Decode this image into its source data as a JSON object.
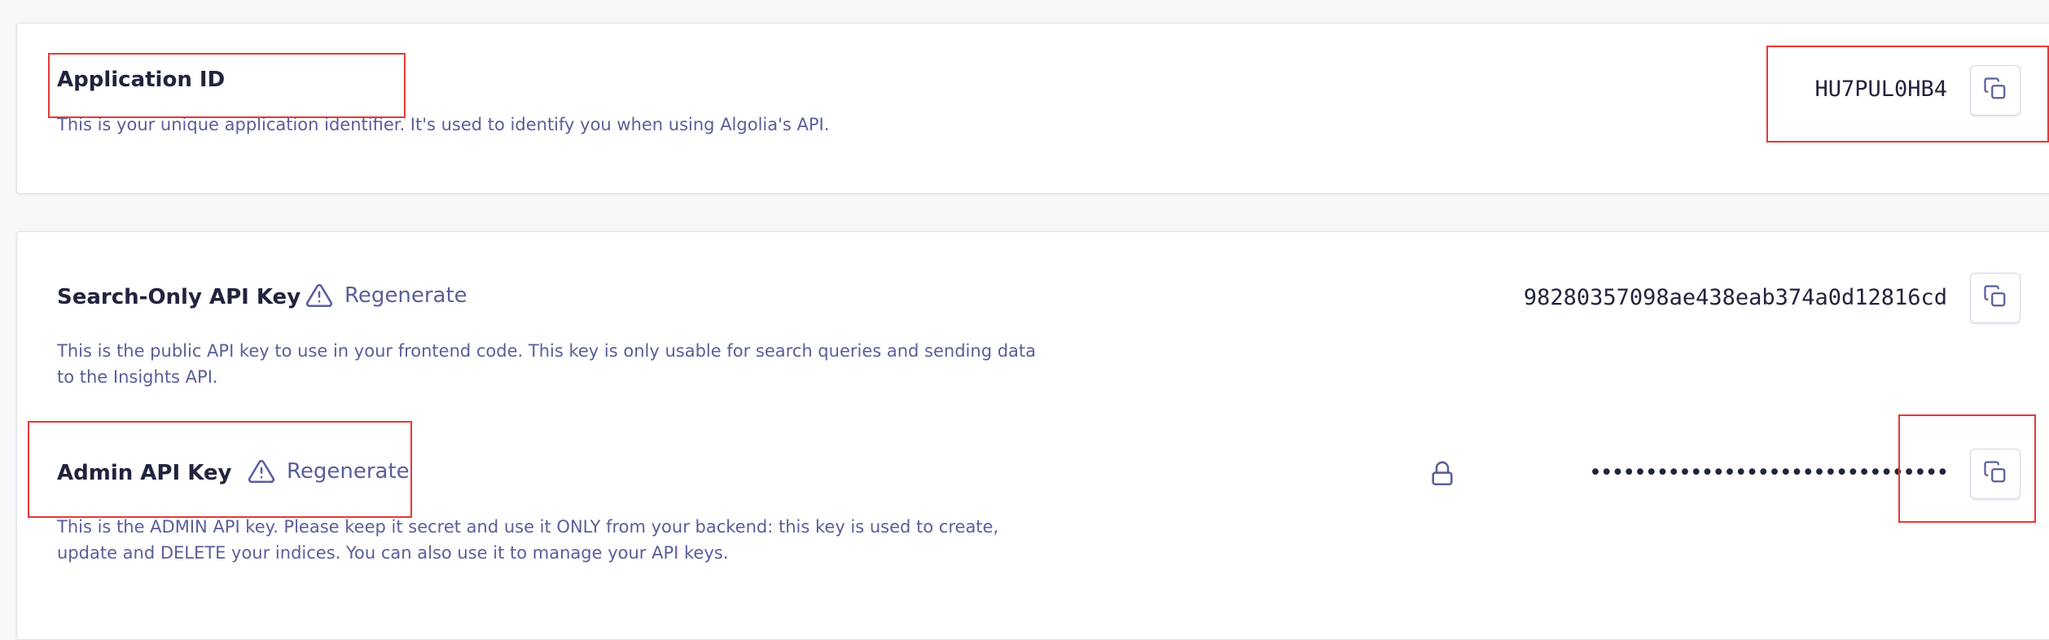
{
  "app_id_card": {
    "title": "Application ID",
    "description": "This is your unique application identifier. It's used to identify you when using Algolia's API.",
    "value": "HU7PUL0HB4",
    "copy_icon": "copy-icon"
  },
  "search_key_card": {
    "title": "Search-Only API Key",
    "regenerate_label": "Regenerate",
    "regenerate_icon": "warning-icon",
    "description_line1": "This is the public API key to use in your frontend code. This key is only usable for search queries and sending data",
    "description_line2": "to the Insights API.",
    "value": "98280357098ae438eab374a0d12816cd",
    "copy_icon": "copy-icon"
  },
  "admin_key_card": {
    "title": "Admin API Key",
    "regenerate_label": "Regenerate",
    "regenerate_icon": "warning-icon",
    "description_line1": "This is the ADMIN API key. Please keep it secret and use it ONLY from your backend: this key is used to create,",
    "description_line2": "update and DELETE your indices. You can also use it to manage your API keys.",
    "value": "••••••••••••••••••••••••••••••••",
    "lock_icon": "lock-icon",
    "copy_icon": "copy-icon"
  },
  "colors": {
    "title": "#21243d",
    "description": "#5a5e9a",
    "highlight": "#e53935"
  }
}
